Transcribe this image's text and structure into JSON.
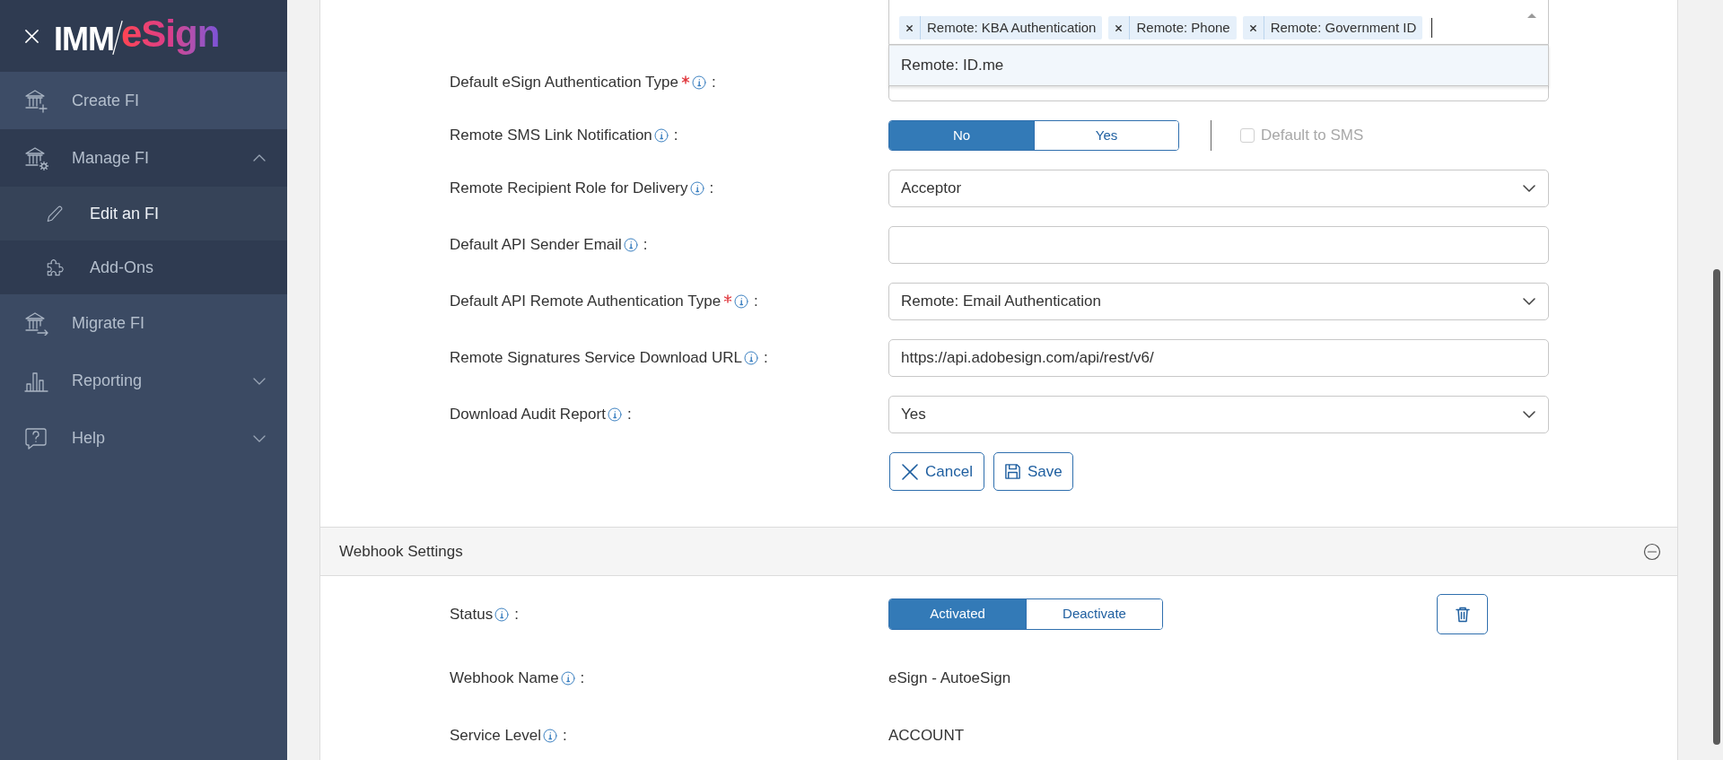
{
  "sidebar": {
    "logo": {
      "part_1": "IMM",
      "part_2": "eSign"
    },
    "items": [
      {
        "label": "Create FI",
        "selected": false
      },
      {
        "label": "Manage FI",
        "selected": false,
        "expanded": true,
        "children": [
          {
            "label": "Edit an FI",
            "selected": true
          },
          {
            "label": "Add-Ons",
            "selected": false
          }
        ]
      },
      {
        "label": "Migrate FI",
        "selected": false
      },
      {
        "label": "Reporting",
        "selected": false,
        "expanded": false
      },
      {
        "label": "Help",
        "selected": false,
        "expanded": false
      }
    ]
  },
  "form": {
    "rows": [
      {
        "kind": "tags",
        "tags": [
          {
            "text": "Remote: KBA Authentication",
            "bold": false
          },
          {
            "text": "Remote: Phone",
            "bold": false
          },
          {
            "text": "Remote: Government ID",
            "bold": false
          }
        ],
        "dropdown": [
          {
            "text": "Remote: ID.me",
            "highlighted": true
          }
        ]
      },
      {
        "kind": "select",
        "label": "Default eSign Authentication Type",
        "required": true,
        "colon": ":"
      },
      {
        "kind": "toggle",
        "label": "Remote SMS Link Notification",
        "required": false,
        "colon": ":",
        "options": [
          {
            "label": "No",
            "selected": true
          },
          {
            "label": "Yes",
            "selected": false
          }
        ],
        "checkbox": {
          "label": "Default to SMS",
          "checked": false,
          "disabled": true
        }
      },
      {
        "kind": "select",
        "label": "Remote Recipient Role for Delivery",
        "required": false,
        "colon": ":",
        "value": "Acceptor"
      },
      {
        "kind": "input",
        "label": "Default API Sender Email",
        "required": false,
        "colon": ":"
      },
      {
        "kind": "select",
        "label": "Default API Remote Authentication Type",
        "required": true,
        "colon": ":",
        "value": "Remote: Email Authentication"
      },
      {
        "kind": "input",
        "label": "Remote Signatures Service Download URL",
        "required": false,
        "colon": ":",
        "value": "https://api.adobesign.com/api/rest/v6/"
      },
      {
        "kind": "select",
        "label": "Download Audit Report",
        "required": false,
        "colon": ":",
        "value": "Yes"
      }
    ],
    "buttons": [
      {
        "kind": "cancel",
        "label": "Cancel"
      },
      {
        "kind": "save",
        "label": "Save"
      }
    ]
  },
  "webhook": {
    "title": "Webhook Settings",
    "expanded": true,
    "rows": [
      {
        "kind": "toggle",
        "label": "Status",
        "required": false,
        "colon": ":",
        "options": [
          {
            "label": "Activated",
            "selected": true
          },
          {
            "label": "Deactivate",
            "selected": false
          }
        ]
      },
      {
        "kind": "text",
        "label": "Webhook Name",
        "required": false,
        "colon": ":",
        "value": "eSign - AutoeSign"
      },
      {
        "kind": "text",
        "label": "Service Level",
        "required": false,
        "colon": ":",
        "value": "ACCOUNT"
      }
    ]
  }
}
